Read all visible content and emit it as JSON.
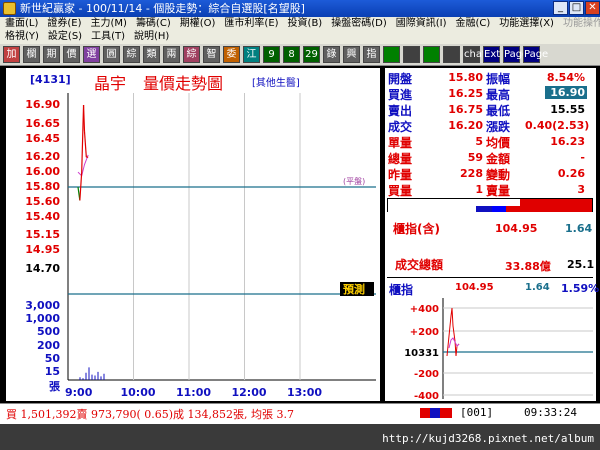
{
  "window": {
    "title": "新世紀贏家 - 100/11/14 - 個股走勢：綜合自選股[名望股]"
  },
  "menu1": [
    "畫面(L)",
    "證券(E)",
    "主力(M)",
    "籌碼(C)",
    "期權(O)",
    "匯市利率(E)",
    "投資(B)",
    "操盤密碼(D)",
    "國際資訊(I)",
    "金融(C)",
    "功能選擇(X)",
    "功能操作(F)"
  ],
  "menu2": [
    "格視(Y)",
    "設定(S)",
    "工具(T)",
    "說明(H)"
  ],
  "toolbar": [
    "加",
    "欄",
    "期",
    "價",
    "選",
    "圓",
    "綜",
    "類",
    "兩",
    "綜",
    "智",
    "委",
    "江",
    "9",
    "8",
    "29",
    "錄",
    "興",
    "指",
    "",
    "",
    "",
    "",
    "chat",
    "Ext",
    "Page",
    "Page"
  ],
  "stock": {
    "code": "[4131]",
    "name": "晶宇",
    "chart_title": "量價走勢圖",
    "category": "[其他生醫]"
  },
  "chart_data": {
    "type": "line",
    "price_ticks": [
      "16.90",
      "16.65",
      "16.45",
      "16.20",
      "16.00",
      "15.80",
      "15.60",
      "15.40",
      "15.15",
      "14.95",
      "14.70"
    ],
    "volume_ticks": [
      "3,000",
      "1,000",
      "500",
      "200",
      "50",
      "15",
      "張"
    ],
    "time_ticks": [
      "9:00",
      "10:00",
      "11:00",
      "12:00",
      "13:00"
    ],
    "reference_price": 15.8,
    "reference_label": "(平盤)",
    "tag": "預測",
    "price_series": [
      {
        "t": "9:00",
        "p": 15.8
      },
      {
        "t": "9:02",
        "p": 15.62
      },
      {
        "t": "9:04",
        "p": 16.0
      },
      {
        "t": "9:06",
        "p": 16.9
      },
      {
        "t": "9:07",
        "p": 16.55
      },
      {
        "t": "9:09",
        "p": 16.2
      },
      {
        "t": "9:11",
        "p": 16.2
      }
    ],
    "avg_series": [
      {
        "t": "9:00",
        "p": 16.0
      },
      {
        "t": "9:04",
        "p": 15.95
      },
      {
        "t": "9:07",
        "p": 16.1
      },
      {
        "t": "9:11",
        "p": 16.23
      }
    ],
    "volumes": [
      3,
      2,
      8,
      14,
      6,
      5,
      9,
      4,
      7
    ]
  },
  "quote": {
    "open_label": "開盤",
    "open": "15.80",
    "amplitude_label": "振幅",
    "amplitude": "8.54%",
    "bid_label": "買進",
    "bid": "16.25",
    "high_label": "最高",
    "high": "16.90",
    "ask_label": "賣出",
    "ask": "16.75",
    "low_label": "最低",
    "low": "15.55",
    "last_label": "成交",
    "last": "16.20",
    "change_label": "漲跌",
    "change": "0.40(2.53)",
    "vol_label": "單量",
    "vol": "5",
    "avg_label": "均價",
    "avg": "16.23",
    "total_label": "總量",
    "total": "59",
    "amount_label": "金額",
    "amount": "-",
    "prev_label": "昨量",
    "prev": "228",
    "shift_label": "變動",
    "shift": "0.26",
    "buyvol_label": "買量",
    "buyvol": "1",
    "sellvol_label": "賣量",
    "sellvol": "3"
  },
  "index": {
    "otc_label": "櫃指(含)",
    "otc_value": "104.95",
    "otc_change": "1.64",
    "turnover_label": "成交總額",
    "turnover": "33.88億",
    "turnover_extra": "25.1",
    "mini_label": "櫃指",
    "mini_value": "104.95",
    "mini_change": "1.64",
    "mini_pct": "1.59%",
    "mini_ticks": [
      "+400",
      "+200",
      "10331",
      "-200",
      "-400"
    ]
  },
  "status": {
    "line": "買 1,501,392賣 973,790( 0.65)成 134,852張, 均張 3.7",
    "page": "001",
    "time": "09:33:24"
  },
  "watermark": "http://kujd3268.pixnet.net/album"
}
